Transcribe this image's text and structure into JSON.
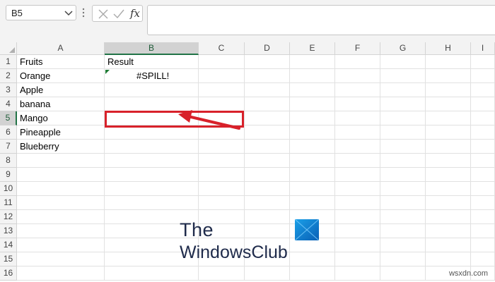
{
  "formula_bar": {
    "name_box": "B5",
    "cancel_icon": "x-icon",
    "enter_icon": "check-icon",
    "fx_label": "fx",
    "formula": ""
  },
  "columns": [
    "A",
    "B",
    "C",
    "D",
    "E",
    "F",
    "G",
    "H",
    "I"
  ],
  "selected_column": "B",
  "rows": [
    "1",
    "2",
    "3",
    "4",
    "5",
    "6",
    "7",
    "8",
    "9",
    "10",
    "11",
    "12",
    "13",
    "14",
    "15",
    "16"
  ],
  "selected_row": "5",
  "cells": {
    "A1": "Fruits",
    "A2": "Orange",
    "A3": "Apple",
    "A4": "banana",
    "A5": "Mango",
    "A6": "Pineapple",
    "A7": "Blueberry",
    "B1": "Result",
    "B2": "#SPILL!"
  },
  "annotation": {
    "color": "#d8212a"
  },
  "watermark": {
    "line1": "The",
    "line2": "WindowsClub",
    "site": "wsxdn.com"
  },
  "colors": {
    "excel_green": "#217346",
    "error_flag": "#1e7b34"
  }
}
